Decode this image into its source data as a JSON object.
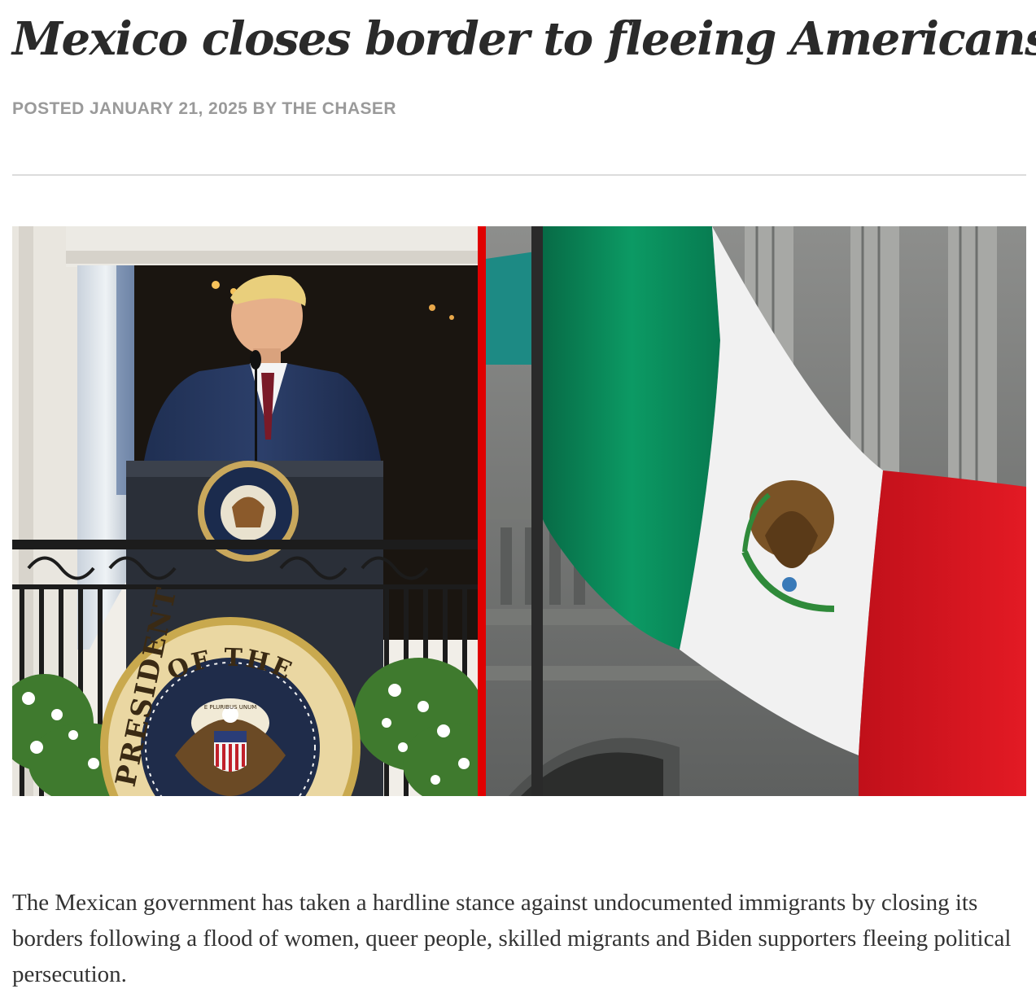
{
  "article": {
    "headline": "Mexico closes border to fleeing Americans",
    "byline": "POSTED JANUARY 21, 2025 BY THE CHASER",
    "paragraph": "The Mexican government has taken a hardline stance against undocumented immigrants by closing its borders following a flood of women, queer people, skilled migrants and Biden supporters fleeing political persecution."
  },
  "image": {
    "seal_top_text": "OF THE",
    "seal_left_text": "PRESIDENT",
    "seal_ribbon_text": "E PLURIBUS UNUM",
    "divider_color": "#e00000",
    "flag_colors": {
      "green": "#0a8a5c",
      "white": "#f1f1f1",
      "red": "#d3121c"
    },
    "left_panel": "president-at-podium",
    "right_panel": "mexican-flag"
  }
}
